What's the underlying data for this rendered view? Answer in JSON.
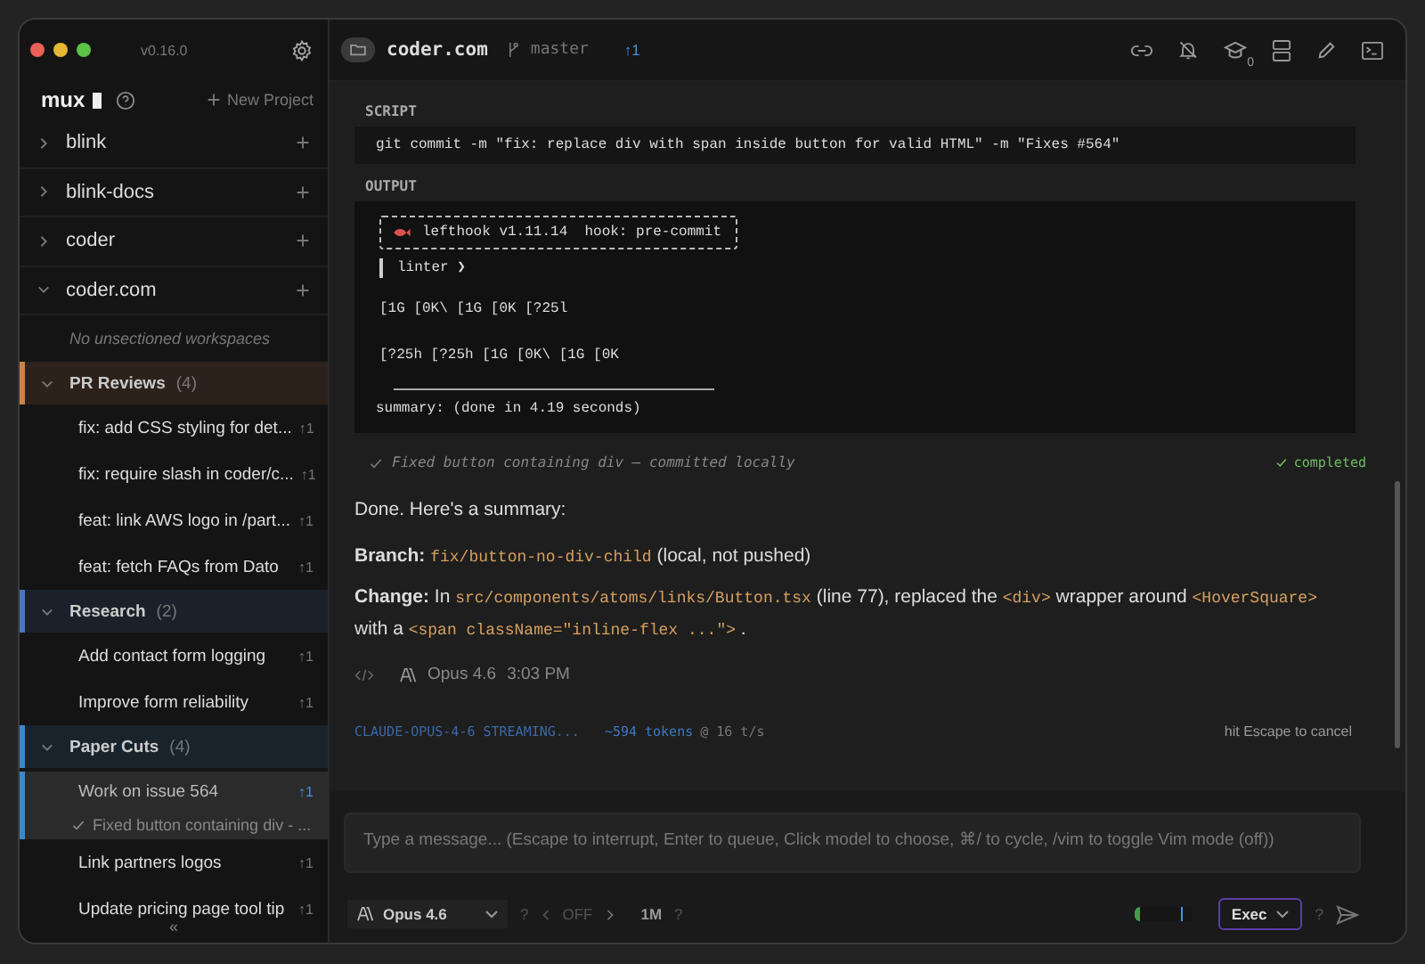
{
  "window": {
    "version": "v0.16.0"
  },
  "sidebar": {
    "brand": "mux",
    "new_project": "New Project",
    "projects": [
      {
        "name": "blink",
        "expanded": false
      },
      {
        "name": "blink-docs",
        "expanded": false
      },
      {
        "name": "coder",
        "expanded": false
      },
      {
        "name": "coder.com",
        "expanded": true,
        "empty_note": "No unsectioned workspaces",
        "sections": [
          {
            "name": "PR Reviews",
            "count": "(4)",
            "color": "#c9834a",
            "expanded": true,
            "workspaces": [
              {
                "title": "fix: add CSS styling for det...",
                "badge": "↑1",
                "selected": false
              },
              {
                "title": "fix: require slash in coder/c...",
                "badge": "↑1",
                "selected": false
              },
              {
                "title": "feat: link AWS logo in /part...",
                "badge": "↑1",
                "selected": false
              },
              {
                "title": "feat: fetch FAQs from Dato",
                "badge": "↑1",
                "selected": false
              }
            ]
          },
          {
            "name": "Research",
            "count": "(2)",
            "color": "#4a78b8",
            "expanded": true,
            "workspaces": [
              {
                "title": "Add contact form logging",
                "badge": "↑1",
                "selected": false
              },
              {
                "title": "Improve form reliability",
                "badge": "↑1",
                "selected": false
              }
            ]
          },
          {
            "name": "Paper Cuts",
            "count": "(4)",
            "color": "#3f86c6",
            "expanded": true,
            "workspaces": [
              {
                "title": "Work on issue 564",
                "badge": "↑1",
                "selected": true,
                "status": "Fixed button containing div - ..."
              },
              {
                "title": "Link partners logos",
                "badge": "↑1",
                "selected": false
              },
              {
                "title": "Update pricing page tool tip",
                "badge": "↑1",
                "selected": false
              }
            ]
          }
        ]
      }
    ],
    "collapse": "«"
  },
  "header": {
    "project": "coder.com",
    "branch": "master",
    "ahead": "↑1",
    "notifications": "0"
  },
  "tool_call": {
    "script_label": "SCRIPT",
    "script": "git commit -m \"fix: replace div with span inside button for valid HTML\" -m \"Fixes #564\"",
    "output_label": "OUTPUT",
    "banner": "lefthook v1.11.14  hook: pre-commit",
    "lines": [
      "linter ❯",
      "[1G [0K\\ [1G [0K [?25l",
      "[?25h [?25h [1G [0K\\ [1G [0K"
    ],
    "summary": "summary: (done in 4.19 seconds)",
    "result": "Fixed button containing div – committed locally",
    "status": "completed"
  },
  "message": {
    "intro": "Done. Here's a summary:",
    "paragraphs": [
      [
        {
          "kind": "label",
          "text": "Branch:"
        },
        {
          "kind": "code",
          "text": "fix/button-no-div-child"
        },
        {
          "kind": "text",
          "text": "(local, not pushed)"
        }
      ],
      [
        {
          "kind": "label",
          "text": "Change:"
        },
        {
          "kind": "text",
          "text": "In"
        },
        {
          "kind": "code",
          "text": "src/components/atoms/links/Button.tsx"
        },
        {
          "kind": "text",
          "text": "(line 77), replaced the"
        },
        {
          "kind": "code",
          "text": "<div>"
        },
        {
          "kind": "text",
          "text": "wrapper around"
        },
        {
          "kind": "code",
          "text": "<HoverSquare>"
        },
        {
          "kind": "text",
          "text": "with a"
        },
        {
          "kind": "code",
          "text": "<span className=\"inline-flex ...\">"
        },
        {
          "kind": "text",
          "text": "."
        }
      ]
    ],
    "model": "Opus 4.6",
    "time": "3:03 PM"
  },
  "streaming": {
    "status": "CLAUDE-OPUS-4-6 STREAMING...",
    "tokens": "~594 tokens",
    "rate": "@ 16 t/s",
    "hint": "hit Escape to cancel"
  },
  "composer": {
    "placeholder": "Type a message... (Escape to interrupt, Enter to queue, Click model to choose, ⌘/ to cycle, /vim to toggle Vim mode (off))"
  },
  "footer": {
    "model": "Opus 4.6",
    "model_help": "?",
    "thinking": "OFF",
    "context": "1M",
    "context_help": "?",
    "context_meter": {
      "level": 0.08
    },
    "mode": "Exec",
    "mode_help": "?"
  }
}
